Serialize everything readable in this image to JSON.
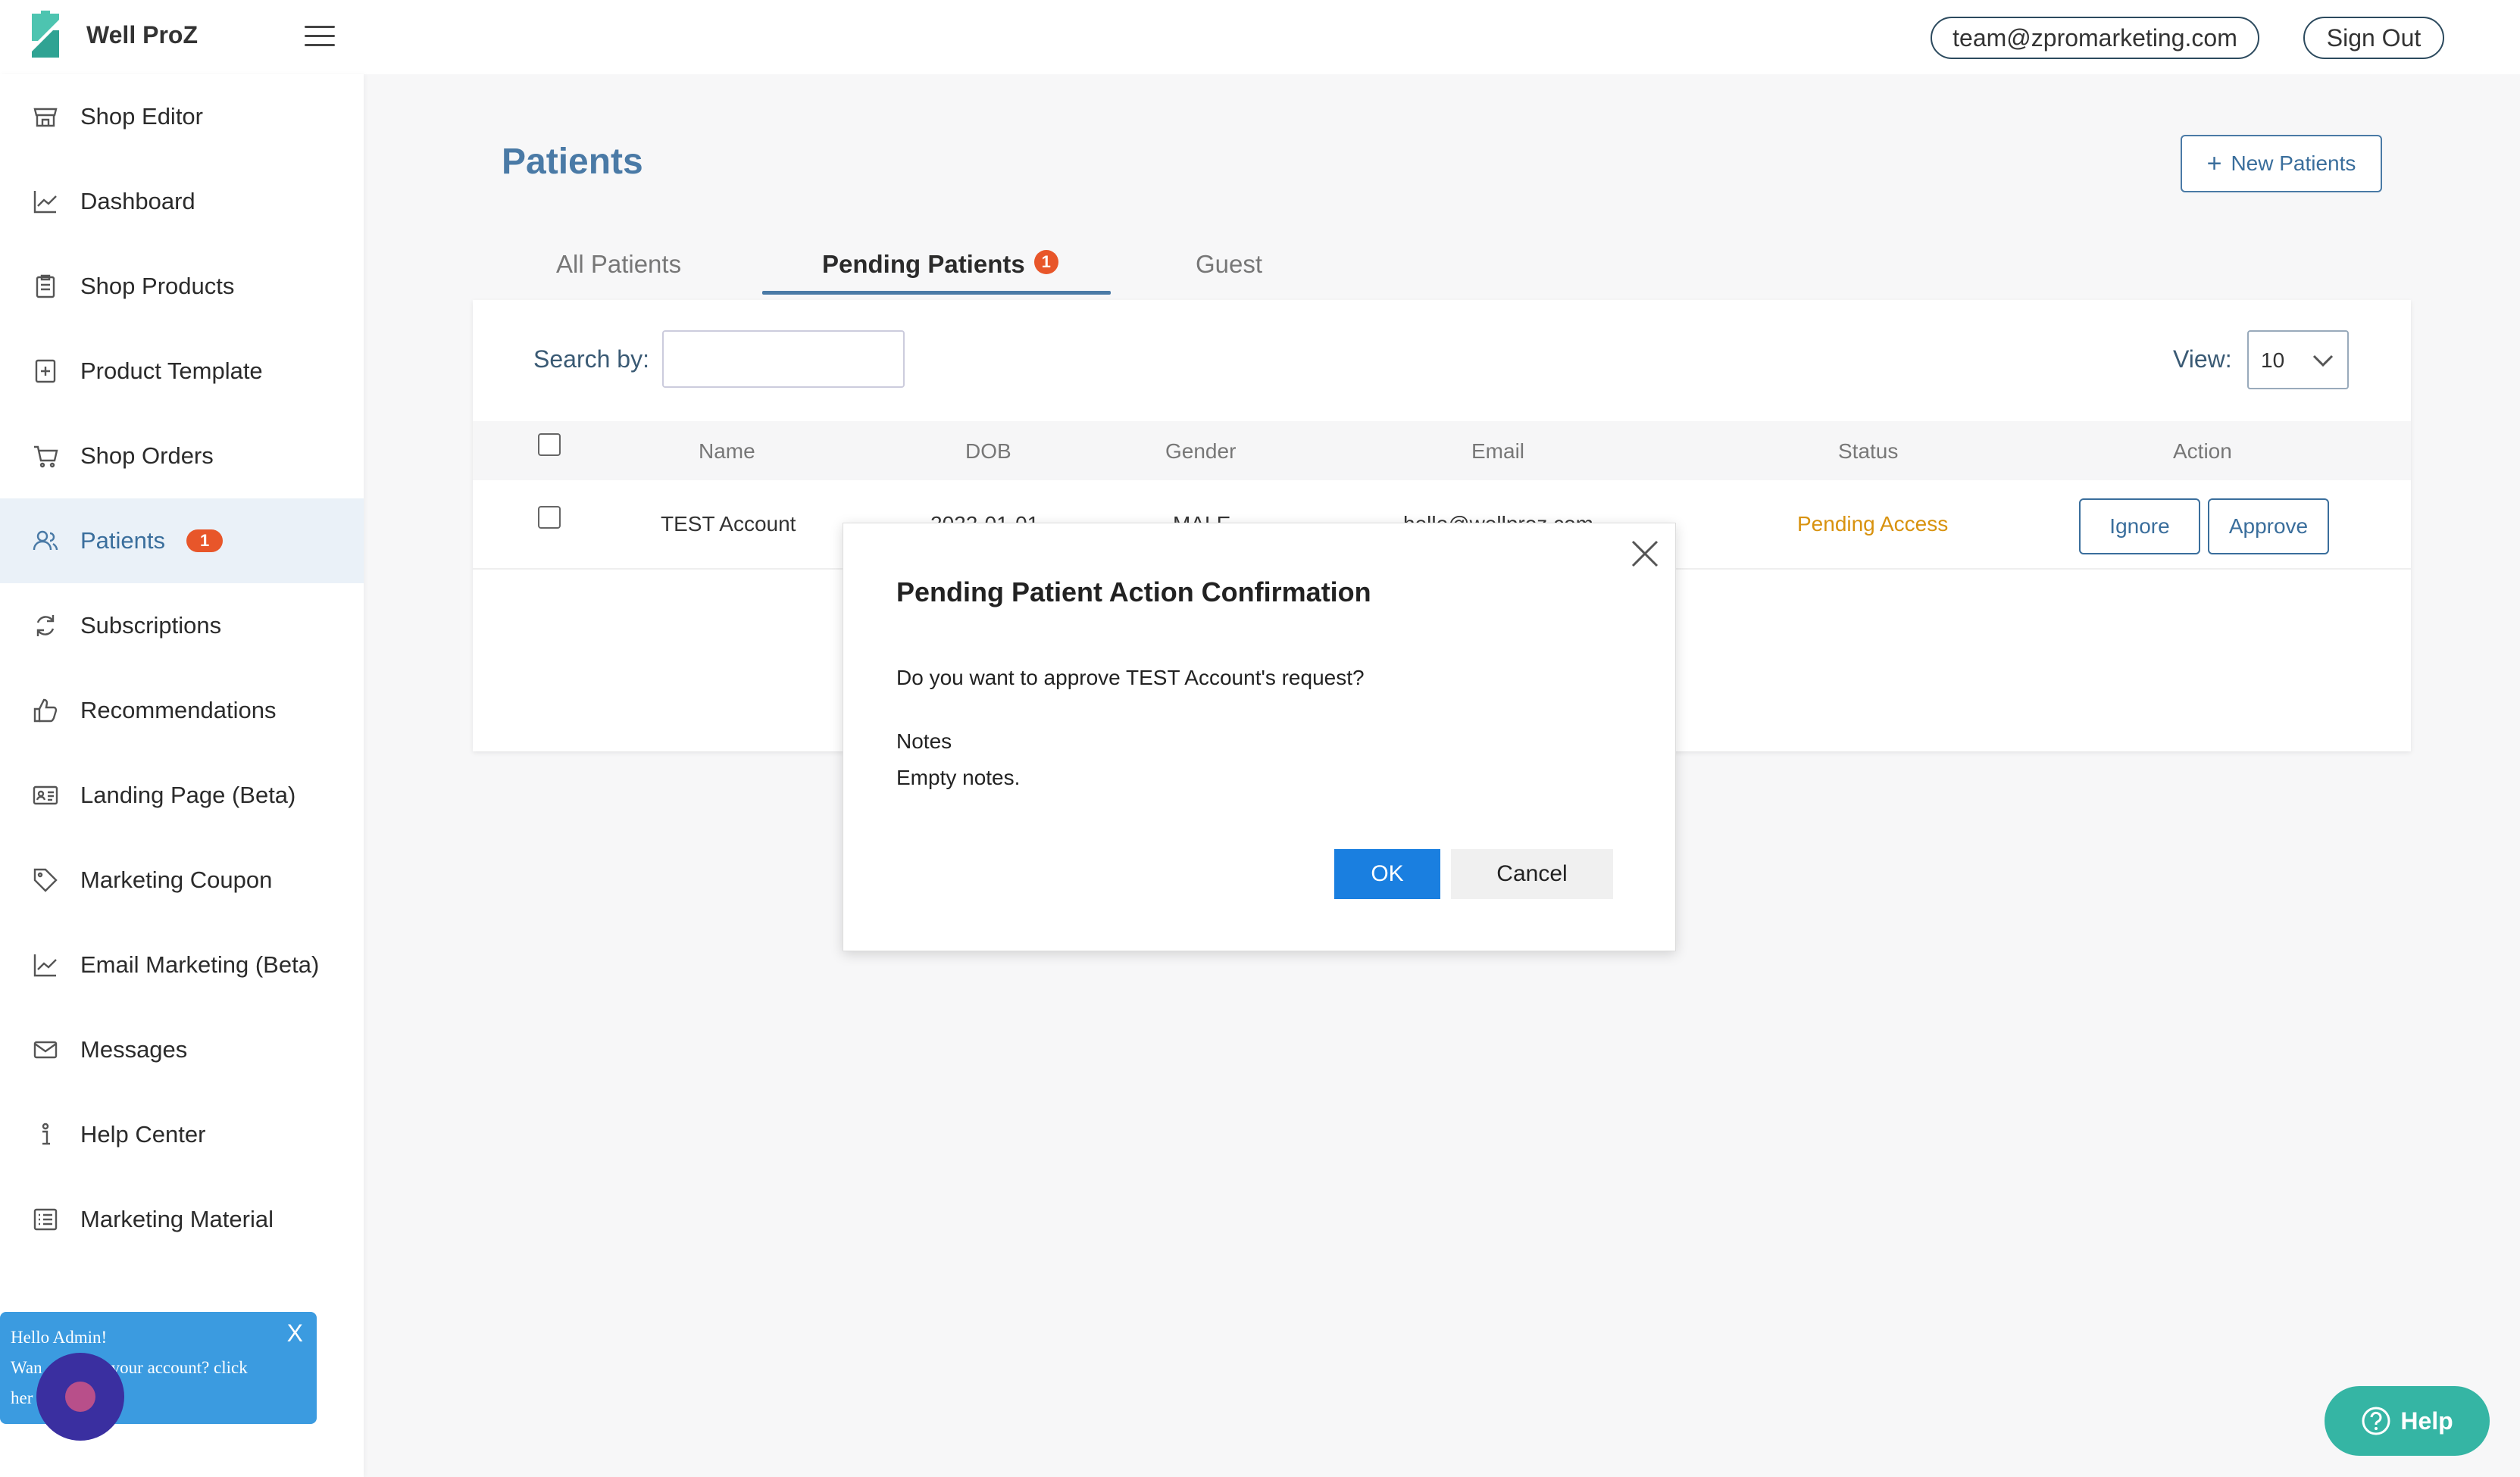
{
  "header": {
    "brand": "Well ProZ",
    "email": "team@zpromarketing.com",
    "sign_out": "Sign Out"
  },
  "sidebar": {
    "items": [
      {
        "label": "Shop Editor",
        "icon": "store-icon"
      },
      {
        "label": "Dashboard",
        "icon": "chart-line-icon"
      },
      {
        "label": "Shop Products",
        "icon": "clipboard-icon"
      },
      {
        "label": "Product Template",
        "icon": "template-add-icon"
      },
      {
        "label": "Shop Orders",
        "icon": "cart-icon"
      },
      {
        "label": "Patients",
        "icon": "users-icon",
        "badge": "1",
        "active": true
      },
      {
        "label": "Subscriptions",
        "icon": "refresh-icon"
      },
      {
        "label": "Recommendations",
        "icon": "thumbs-up-icon"
      },
      {
        "label": "Landing Page (Beta)",
        "icon": "id-card-icon"
      },
      {
        "label": "Marketing Coupon",
        "icon": "tag-icon"
      },
      {
        "label": "Email Marketing (Beta)",
        "icon": "chart-line-icon"
      },
      {
        "label": "Messages",
        "icon": "mail-icon"
      },
      {
        "label": "Help Center",
        "icon": "info-icon"
      },
      {
        "label": "Marketing Material",
        "icon": "list-icon"
      }
    ]
  },
  "toast": {
    "line1": "Hello Admin!",
    "line2": "Wan",
    "line2b": "ck to your account? click",
    "line3": "her",
    "close": "X"
  },
  "main": {
    "title": "Patients",
    "new_button": "New Patients",
    "tabs": [
      {
        "label": "All Patients"
      },
      {
        "label": "Pending Patients",
        "badge": "1",
        "active": true
      },
      {
        "label": "Guest"
      }
    ],
    "search_label": "Search by:",
    "search_value": "",
    "view_label": "View:",
    "view_value": "10",
    "columns": [
      "Name",
      "DOB",
      "Gender",
      "Email",
      "Status",
      "Action"
    ],
    "rows": [
      {
        "name": "TEST Account",
        "dob": "2022-01-01",
        "gender": "MALE",
        "email": "hello@wellproz.com",
        "status": "Pending Access",
        "actions": [
          "Ignore",
          "Approve"
        ]
      }
    ]
  },
  "modal": {
    "title": "Pending Patient Action Confirmation",
    "question": "Do you want to approve TEST Account's request?",
    "notes_label": "Notes",
    "notes_value": "Empty notes.",
    "ok": "OK",
    "cancel": "Cancel"
  },
  "help": {
    "label": "Help"
  },
  "colors": {
    "accent": "#4a7aa6",
    "badge": "#e8562a",
    "status_pending": "#d8920e",
    "ok_button": "#1a7fe0",
    "help_button": "#35b5a4",
    "toast": "#3b9be0"
  }
}
